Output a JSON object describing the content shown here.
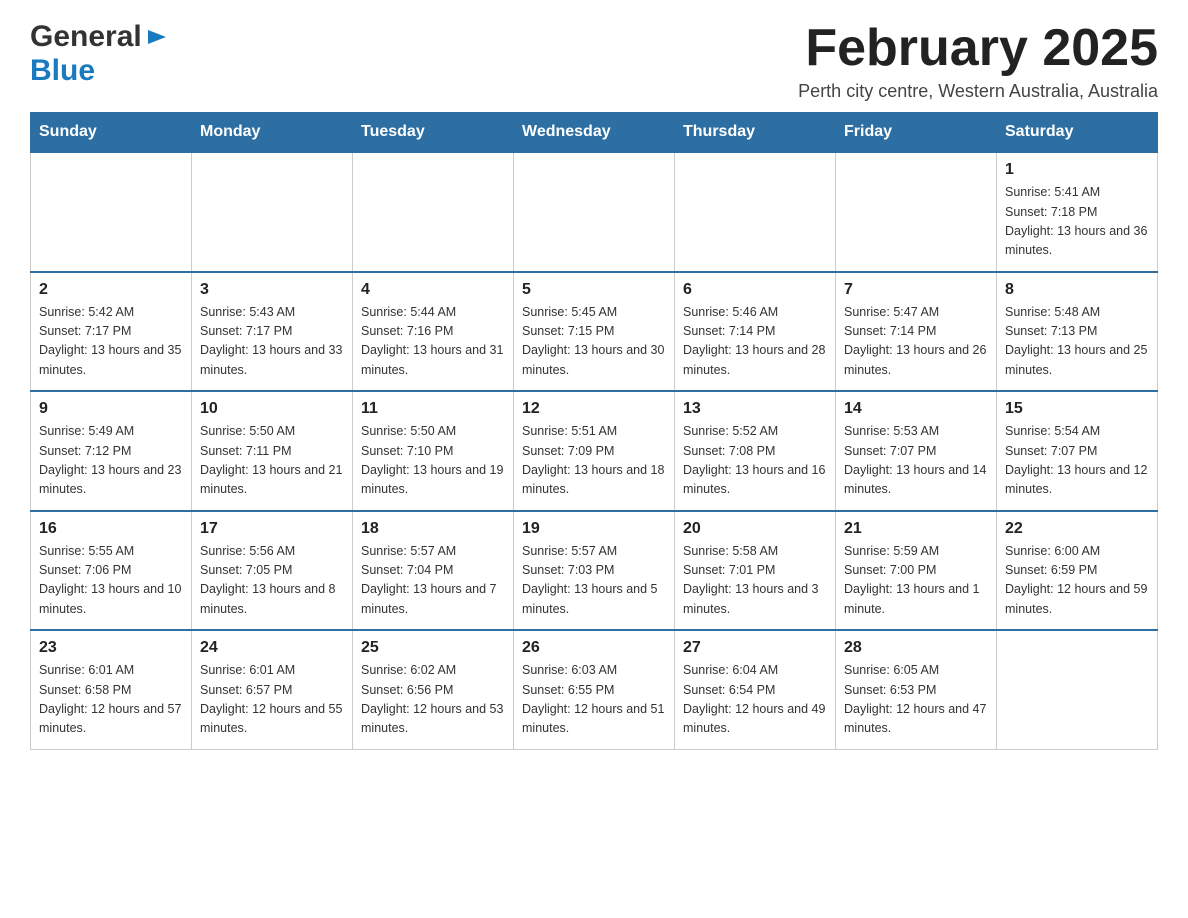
{
  "header": {
    "logo": {
      "general": "General",
      "blue": "Blue",
      "arrow": "▶"
    },
    "title": "February 2025",
    "subtitle": "Perth city centre, Western Australia, Australia"
  },
  "weekdays": [
    "Sunday",
    "Monday",
    "Tuesday",
    "Wednesday",
    "Thursday",
    "Friday",
    "Saturday"
  ],
  "weeks": [
    [
      {
        "day": "",
        "sunrise": "",
        "sunset": "",
        "daylight": ""
      },
      {
        "day": "",
        "sunrise": "",
        "sunset": "",
        "daylight": ""
      },
      {
        "day": "",
        "sunrise": "",
        "sunset": "",
        "daylight": ""
      },
      {
        "day": "",
        "sunrise": "",
        "sunset": "",
        "daylight": ""
      },
      {
        "day": "",
        "sunrise": "",
        "sunset": "",
        "daylight": ""
      },
      {
        "day": "",
        "sunrise": "",
        "sunset": "",
        "daylight": ""
      },
      {
        "day": "1",
        "sunrise": "Sunrise: 5:41 AM",
        "sunset": "Sunset: 7:18 PM",
        "daylight": "Daylight: 13 hours and 36 minutes."
      }
    ],
    [
      {
        "day": "2",
        "sunrise": "Sunrise: 5:42 AM",
        "sunset": "Sunset: 7:17 PM",
        "daylight": "Daylight: 13 hours and 35 minutes."
      },
      {
        "day": "3",
        "sunrise": "Sunrise: 5:43 AM",
        "sunset": "Sunset: 7:17 PM",
        "daylight": "Daylight: 13 hours and 33 minutes."
      },
      {
        "day": "4",
        "sunrise": "Sunrise: 5:44 AM",
        "sunset": "Sunset: 7:16 PM",
        "daylight": "Daylight: 13 hours and 31 minutes."
      },
      {
        "day": "5",
        "sunrise": "Sunrise: 5:45 AM",
        "sunset": "Sunset: 7:15 PM",
        "daylight": "Daylight: 13 hours and 30 minutes."
      },
      {
        "day": "6",
        "sunrise": "Sunrise: 5:46 AM",
        "sunset": "Sunset: 7:14 PM",
        "daylight": "Daylight: 13 hours and 28 minutes."
      },
      {
        "day": "7",
        "sunrise": "Sunrise: 5:47 AM",
        "sunset": "Sunset: 7:14 PM",
        "daylight": "Daylight: 13 hours and 26 minutes."
      },
      {
        "day": "8",
        "sunrise": "Sunrise: 5:48 AM",
        "sunset": "Sunset: 7:13 PM",
        "daylight": "Daylight: 13 hours and 25 minutes."
      }
    ],
    [
      {
        "day": "9",
        "sunrise": "Sunrise: 5:49 AM",
        "sunset": "Sunset: 7:12 PM",
        "daylight": "Daylight: 13 hours and 23 minutes."
      },
      {
        "day": "10",
        "sunrise": "Sunrise: 5:50 AM",
        "sunset": "Sunset: 7:11 PM",
        "daylight": "Daylight: 13 hours and 21 minutes."
      },
      {
        "day": "11",
        "sunrise": "Sunrise: 5:50 AM",
        "sunset": "Sunset: 7:10 PM",
        "daylight": "Daylight: 13 hours and 19 minutes."
      },
      {
        "day": "12",
        "sunrise": "Sunrise: 5:51 AM",
        "sunset": "Sunset: 7:09 PM",
        "daylight": "Daylight: 13 hours and 18 minutes."
      },
      {
        "day": "13",
        "sunrise": "Sunrise: 5:52 AM",
        "sunset": "Sunset: 7:08 PM",
        "daylight": "Daylight: 13 hours and 16 minutes."
      },
      {
        "day": "14",
        "sunrise": "Sunrise: 5:53 AM",
        "sunset": "Sunset: 7:07 PM",
        "daylight": "Daylight: 13 hours and 14 minutes."
      },
      {
        "day": "15",
        "sunrise": "Sunrise: 5:54 AM",
        "sunset": "Sunset: 7:07 PM",
        "daylight": "Daylight: 13 hours and 12 minutes."
      }
    ],
    [
      {
        "day": "16",
        "sunrise": "Sunrise: 5:55 AM",
        "sunset": "Sunset: 7:06 PM",
        "daylight": "Daylight: 13 hours and 10 minutes."
      },
      {
        "day": "17",
        "sunrise": "Sunrise: 5:56 AM",
        "sunset": "Sunset: 7:05 PM",
        "daylight": "Daylight: 13 hours and 8 minutes."
      },
      {
        "day": "18",
        "sunrise": "Sunrise: 5:57 AM",
        "sunset": "Sunset: 7:04 PM",
        "daylight": "Daylight: 13 hours and 7 minutes."
      },
      {
        "day": "19",
        "sunrise": "Sunrise: 5:57 AM",
        "sunset": "Sunset: 7:03 PM",
        "daylight": "Daylight: 13 hours and 5 minutes."
      },
      {
        "day": "20",
        "sunrise": "Sunrise: 5:58 AM",
        "sunset": "Sunset: 7:01 PM",
        "daylight": "Daylight: 13 hours and 3 minutes."
      },
      {
        "day": "21",
        "sunrise": "Sunrise: 5:59 AM",
        "sunset": "Sunset: 7:00 PM",
        "daylight": "Daylight: 13 hours and 1 minute."
      },
      {
        "day": "22",
        "sunrise": "Sunrise: 6:00 AM",
        "sunset": "Sunset: 6:59 PM",
        "daylight": "Daylight: 12 hours and 59 minutes."
      }
    ],
    [
      {
        "day": "23",
        "sunrise": "Sunrise: 6:01 AM",
        "sunset": "Sunset: 6:58 PM",
        "daylight": "Daylight: 12 hours and 57 minutes."
      },
      {
        "day": "24",
        "sunrise": "Sunrise: 6:01 AM",
        "sunset": "Sunset: 6:57 PM",
        "daylight": "Daylight: 12 hours and 55 minutes."
      },
      {
        "day": "25",
        "sunrise": "Sunrise: 6:02 AM",
        "sunset": "Sunset: 6:56 PM",
        "daylight": "Daylight: 12 hours and 53 minutes."
      },
      {
        "day": "26",
        "sunrise": "Sunrise: 6:03 AM",
        "sunset": "Sunset: 6:55 PM",
        "daylight": "Daylight: 12 hours and 51 minutes."
      },
      {
        "day": "27",
        "sunrise": "Sunrise: 6:04 AM",
        "sunset": "Sunset: 6:54 PM",
        "daylight": "Daylight: 12 hours and 49 minutes."
      },
      {
        "day": "28",
        "sunrise": "Sunrise: 6:05 AM",
        "sunset": "Sunset: 6:53 PM",
        "daylight": "Daylight: 12 hours and 47 minutes."
      },
      {
        "day": "",
        "sunrise": "",
        "sunset": "",
        "daylight": ""
      }
    ]
  ]
}
